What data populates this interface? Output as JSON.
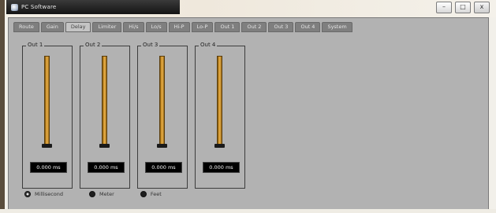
{
  "window": {
    "title": "PC Software",
    "controls": {
      "minimize": "–",
      "maximize": "□",
      "close": "x"
    }
  },
  "tabs": [
    {
      "label": "Route",
      "active": false
    },
    {
      "label": "Gain",
      "active": false
    },
    {
      "label": "Delay",
      "active": true
    },
    {
      "label": "Limiter",
      "active": false
    },
    {
      "label": "Hi/s",
      "active": false
    },
    {
      "label": "Lo/s",
      "active": false
    },
    {
      "label": "Hi-P",
      "active": false
    },
    {
      "label": "Lo-P",
      "active": false
    },
    {
      "label": "Out 1",
      "active": false
    },
    {
      "label": "Out 2",
      "active": false
    },
    {
      "label": "Out 3",
      "active": false
    },
    {
      "label": "Out 4",
      "active": false
    },
    {
      "label": "System",
      "active": false
    }
  ],
  "outputs": [
    {
      "label": "Out 1",
      "delay_value": "0.000 ms",
      "fader_level": 0.0
    },
    {
      "label": "Out 2",
      "delay_value": "0.000 ms",
      "fader_level": 0.0
    },
    {
      "label": "Out 3",
      "delay_value": "0.000 ms",
      "fader_level": 0.0
    },
    {
      "label": "Out 4",
      "delay_value": "0.000 ms",
      "fader_level": 0.0
    }
  ],
  "units": {
    "selected": "Millisecond",
    "options": [
      "Millisecond",
      "Meter",
      "Feet"
    ]
  },
  "colors": {
    "panel": "#b2b2b2",
    "tab": "#7f7f7f",
    "tab_active": "#c4c4c4",
    "fader": "#d89a2e",
    "readout_bg": "#000000",
    "titlebar": "#1e1e1e"
  }
}
